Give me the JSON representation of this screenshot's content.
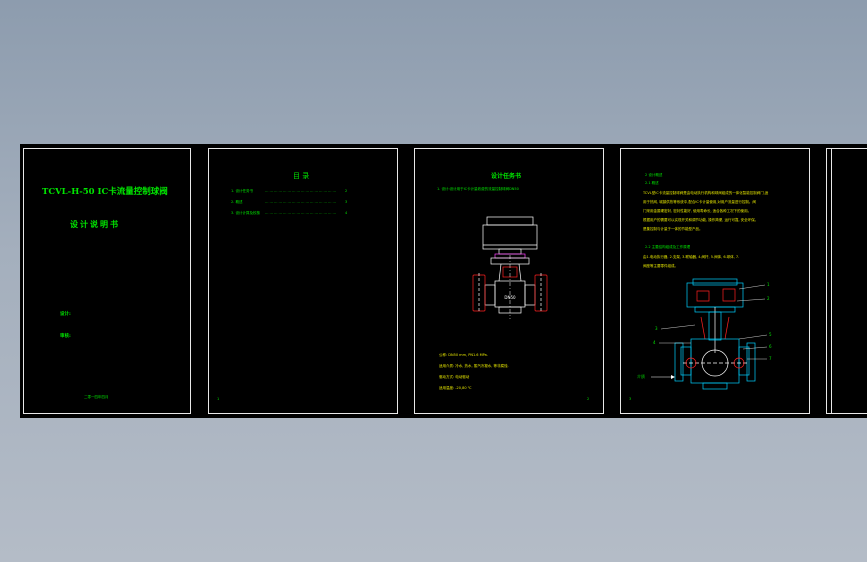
{
  "colors": {
    "background": "#9aa6b6",
    "sheet": "#000000",
    "frame": "#e8e8e8",
    "text_green": "#00e600",
    "text_yellow": "#e6e600",
    "drawing_white": "#ffffff",
    "drawing_red": "#ff2020",
    "drawing_cyan": "#00d0ff",
    "drawing_magenta": "#ff40ff"
  },
  "cover": {
    "title": "TCVL-H-50 IC卡流量控制球阀",
    "subtitle": "设计说明书",
    "field1": "设计:",
    "field2": "审核:",
    "org": "二零一四年四月"
  },
  "toc": {
    "title": "目  录",
    "items": [
      {
        "label": "1. 设计任务书",
        "page": "2"
      },
      {
        "label": "2. 概述",
        "page": "3"
      },
      {
        "label": "3. 设计计算及校核",
        "page": "4"
      }
    ],
    "page_no": "1"
  },
  "task": {
    "title": "设计任务书",
    "line1": "1. 设计:设计用于IC卡计量收费的流量控制球阀DN50",
    "valve_label": "DN50",
    "specs": [
      "公称: DN50 mm, PN1.6 MPa.",
      "适用介质: 冷水, 热水, 蒸汽冷凝水, 等非腐蚀.",
      "驱动方式: 电动驱动",
      "适用温度: -20,80 ℃"
    ],
    "page_no": "2"
  },
  "overview": {
    "heading": "2 设计概述",
    "sub1": "2.1 概述",
    "para": [
      "TCVL型IC卡流量控制球阀是由电动执行机构和球阀组成的一体化智能控制阀门,适",
      "用于热网, 城镇供热等系统中,配合IC卡计量使用,对用户流量进行控制。阀",
      "门采用金属硬密封, 密封性能好, 使用寿命长, 适合各种工况下的使用。",
      "根据用户的需要可以实现开关和调节功能, 操作简便, 运行可靠, 安全环保。",
      "是集控制与计量于一体的节能型产品。"
    ],
    "sub2": "2.2 主要结构组成及工作原理",
    "structure": [
      "由1.电动执行器, 2.支架, 3.联轴器, 4.阀杆, 5.阀体, 6.球体, 7.",
      "阀座等主要零件组成。"
    ],
    "callouts": [
      "1",
      "2",
      "3",
      "4",
      "5",
      "6",
      "7"
    ],
    "flow_label": "介质",
    "page_no": "3"
  }
}
